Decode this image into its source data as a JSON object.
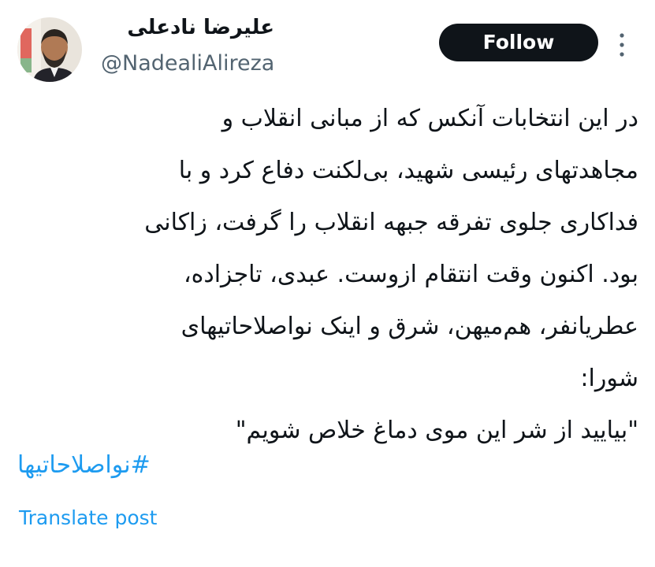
{
  "author": {
    "display_name": "علیرضا نادعلی",
    "handle": "@NadealiAlireza",
    "avatar_icon": "profile-photo"
  },
  "actions": {
    "follow_label": "Follow",
    "more_icon": "more-vertical-icon"
  },
  "post": {
    "lines": [
      "در این انتخابات آنکس که از مبانی انقلاب و",
      "مجاهدتهای رئیسی شهید، بی‌لکنت دفاع کرد و با",
      "فداکاری جلوی تفرقه جبهه انقلاب را گرفت، زاکانی",
      "بود. اکنون وقت انتقام ازوست. عبدی، تاجزاده،",
      "عطریانفر، هم‌میهن، شرق و اینک نواصلاحاتیهای",
      "شورا:",
      "\"بیایید از شر این موی دماغ خلاص شویم\""
    ],
    "hashtag": "#نواصلاحاتیها",
    "translate_label": "Translate post"
  },
  "colors": {
    "link": "#1d9bf0",
    "text": "#0f1419",
    "secondary": "#536471",
    "follow_bg": "#0f1419"
  }
}
